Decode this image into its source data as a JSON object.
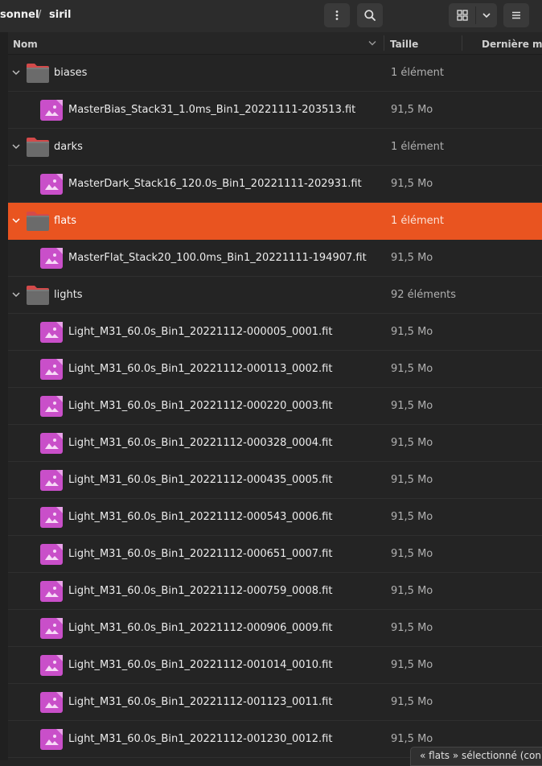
{
  "breadcrumb": {
    "parent": "sonnel",
    "separator": "/",
    "current": "siril"
  },
  "columns": {
    "name": "Nom",
    "size": "Taille",
    "modified": "Dernière mo"
  },
  "rows": [
    {
      "type": "folder",
      "name": "biases",
      "size": "1 élément",
      "expanded": true
    },
    {
      "type": "file",
      "name": "MasterBias_Stack31_1.0ms_Bin1_20221111-203513.fit",
      "size": "91,5 Mo"
    },
    {
      "type": "folder",
      "name": "darks",
      "size": "1 élément",
      "expanded": true
    },
    {
      "type": "file",
      "name": "MasterDark_Stack16_120.0s_Bin1_20221111-202931.fit",
      "size": "91,5 Mo"
    },
    {
      "type": "folder",
      "name": "flats",
      "size": "1 élément",
      "expanded": true,
      "selected": true
    },
    {
      "type": "file",
      "name": "MasterFlat_Stack20_100.0ms_Bin1_20221111-194907.fit",
      "size": "91,5 Mo"
    },
    {
      "type": "folder",
      "name": "lights",
      "size": "92 éléments",
      "expanded": true
    },
    {
      "type": "file",
      "name": "Light_M31_60.0s_Bin1_20221112-000005_0001.fit",
      "size": "91,5 Mo"
    },
    {
      "type": "file",
      "name": "Light_M31_60.0s_Bin1_20221112-000113_0002.fit",
      "size": "91,5 Mo"
    },
    {
      "type": "file",
      "name": "Light_M31_60.0s_Bin1_20221112-000220_0003.fit",
      "size": "91,5 Mo"
    },
    {
      "type": "file",
      "name": "Light_M31_60.0s_Bin1_20221112-000328_0004.fit",
      "size": "91,5 Mo"
    },
    {
      "type": "file",
      "name": "Light_M31_60.0s_Bin1_20221112-000435_0005.fit",
      "size": "91,5 Mo"
    },
    {
      "type": "file",
      "name": "Light_M31_60.0s_Bin1_20221112-000543_0006.fit",
      "size": "91,5 Mo"
    },
    {
      "type": "file",
      "name": "Light_M31_60.0s_Bin1_20221112-000651_0007.fit",
      "size": "91,5 Mo"
    },
    {
      "type": "file",
      "name": "Light_M31_60.0s_Bin1_20221112-000759_0008.fit",
      "size": "91,5 Mo"
    },
    {
      "type": "file",
      "name": "Light_M31_60.0s_Bin1_20221112-000906_0009.fit",
      "size": "91,5 Mo"
    },
    {
      "type": "file",
      "name": "Light_M31_60.0s_Bin1_20221112-001014_0010.fit",
      "size": "91,5 Mo"
    },
    {
      "type": "file",
      "name": "Light_M31_60.0s_Bin1_20221112-001123_0011.fit",
      "size": "91,5 Mo"
    },
    {
      "type": "file",
      "name": "Light_M31_60.0s_Bin1_20221112-001230_0012.fit",
      "size": "91,5 Mo"
    }
  ],
  "status": "« flats » sélectionné  (con",
  "icons": {
    "menu": "vertical-dots-icon",
    "search": "search-icon",
    "grid": "grid-view-icon",
    "dropdown": "chevron-down-icon",
    "hamburger": "hamburger-menu-icon",
    "folder": "folder-icon",
    "image": "image-file-icon"
  },
  "colors": {
    "accent": "#e95420",
    "file_icon": "#c94fc9",
    "background": "#242424"
  }
}
